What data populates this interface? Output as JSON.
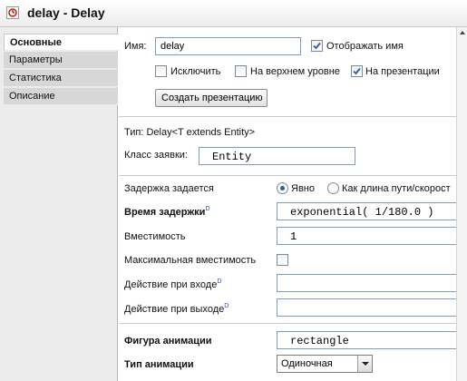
{
  "window": {
    "title": "delay - Delay",
    "icon": "delay-block-icon"
  },
  "tabs": [
    {
      "label": "Основные",
      "active": true
    },
    {
      "label": "Параметры",
      "active": false
    },
    {
      "label": "Статистика",
      "active": false
    },
    {
      "label": "Описание",
      "active": false
    }
  ],
  "form": {
    "name_label": "Имя:",
    "name_value": "delay",
    "show_name_label": "Отображать имя",
    "show_name_checked": true,
    "exclude_label": "Исключить",
    "exclude_checked": false,
    "top_level_label": "На верхнем уровне",
    "top_level_checked": false,
    "on_presentation_label": "На презентации",
    "on_presentation_checked": true,
    "create_presentation_button": "Создать презентацию",
    "type_text": "Тип: Delay<T extends Entity>",
    "entity_class_label": "Класс заявки:",
    "entity_class_value": "Entity",
    "delay_given_label": "Задержка задается",
    "radio_explicit_label": "Явно",
    "radio_path_label": "Как длина пути/скорост",
    "radio_selected": "Явно",
    "delay_time_label": "Время задержки",
    "delay_time_value": "exponential( 1/180.0 )",
    "capacity_label": "Вместимость",
    "capacity_value": "1",
    "max_capacity_label": "Максимальная вместимость",
    "max_capacity_checked": false,
    "on_enter_label": "Действие при входе",
    "on_enter_value": "",
    "on_exit_label": "Действие при выходе",
    "on_exit_value": "",
    "anim_shape_label": "Фигура анимации",
    "anim_shape_value": "rectangle",
    "anim_type_label": "Тип анимации",
    "anim_type_value": "Одиночная",
    "dynamic_marker": "D"
  },
  "colors": {
    "accent_blue": "#2a5aa8",
    "dynamic_marker": "#1f4fb5",
    "title_icon_red": "#c0221c"
  }
}
